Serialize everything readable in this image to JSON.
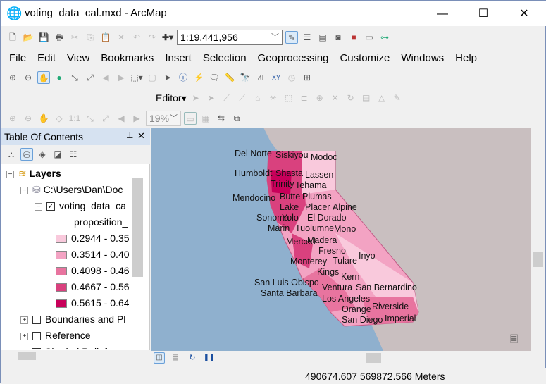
{
  "window": {
    "title": "voting_data_cal.mxd - ArcMap",
    "minimize": "—",
    "maximize": "☐",
    "close": "✕"
  },
  "toolbar": {
    "scale": "1:19,441,956",
    "layout_zoom": "19%",
    "editor": "Editor"
  },
  "menu": [
    "File",
    "Edit",
    "View",
    "Bookmarks",
    "Insert",
    "Selection",
    "Geoprocessing",
    "Customize",
    "Windows",
    "Help"
  ],
  "toc": {
    "title": "Table Of Contents",
    "pin": "⊥",
    "close": "✕",
    "layers_label": "Layers",
    "source": "C:\\Users\\Dan\\Doc",
    "layer": "voting_data_ca",
    "field": "proposition_",
    "legend": [
      {
        "label": "0.2944 - 0.35",
        "color": "#f9c9dc"
      },
      {
        "label": "0.3514 - 0.40",
        "color": "#f3a3c3"
      },
      {
        "label": "0.4098 - 0.46",
        "color": "#e8749f"
      },
      {
        "label": "0.4667 - 0.56",
        "color": "#d9417e"
      },
      {
        "label": "0.5615 - 0.64",
        "color": "#c8005a"
      }
    ],
    "groups": [
      "Boundaries and Pl",
      "Reference",
      "Shaded Relief"
    ]
  },
  "map": {
    "counties": [
      "Del Norte",
      "Siskiyou",
      "Modoc",
      "Humboldt",
      "Shasta",
      "Lassen",
      "Trinity",
      "Tehama",
      "Mendocino",
      "Butte",
      "Plumas",
      "Lake",
      "Placer",
      "Alpine",
      "Sonoma",
      "Yolo",
      "El Dorado",
      "Marin",
      "Tuolumne",
      "Mono",
      "Merced",
      "Madera",
      "Fresno",
      "Inyo",
      "Tulare",
      "Monterey",
      "Kings",
      "Kern",
      "San Luis Obispo",
      "Ventura",
      "San Bernardino",
      "Santa Barbara",
      "Los Angeles",
      "Riverside",
      "Orange",
      "Imperial",
      "San Diego"
    ]
  },
  "status": {
    "coords": "490674.607  569872.566 Meters"
  }
}
